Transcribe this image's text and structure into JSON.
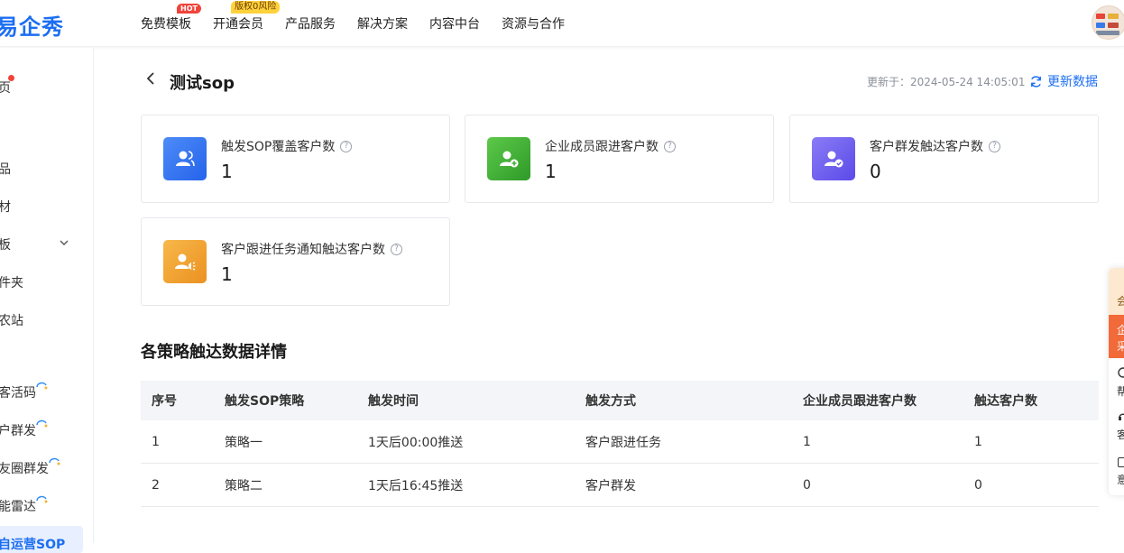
{
  "header": {
    "logo": "易企秀",
    "nav": [
      {
        "label": "免费模板",
        "badge": "HOT"
      },
      {
        "label": "开通会员",
        "badge": "版权0风险"
      },
      {
        "label": "产品服务"
      },
      {
        "label": "解决方案"
      },
      {
        "label": "内容中台"
      },
      {
        "label": "资源与合作"
      }
    ]
  },
  "sidebar": {
    "items": [
      {
        "label": "页"
      },
      {
        "label": "品"
      },
      {
        "label": "材"
      },
      {
        "label": "板"
      },
      {
        "label": "件夹"
      },
      {
        "label": "农站"
      },
      {
        "label": "客活码"
      },
      {
        "label": "户群发"
      },
      {
        "label": "友圈群发"
      },
      {
        "label": "能雷达"
      },
      {
        "label": "自运营SOP"
      }
    ]
  },
  "page": {
    "title": "测试sop",
    "updated_label": "更新于：2024-05-24 14:05:01",
    "refresh_label": "更新数据"
  },
  "stats": [
    {
      "label": "触发SOP覆盖客户数",
      "value": "1",
      "color": "#2f6df3"
    },
    {
      "label": "企业成员跟进客户数",
      "value": "1",
      "color": "#3fae32"
    },
    {
      "label": "客户群发触达客户数",
      "value": "0",
      "color": "#6a5cf0"
    },
    {
      "label": "客户跟进任务通知触达客户数",
      "value": "1",
      "color": "#f0a22c"
    }
  ],
  "detail": {
    "title": "各策略触达数据详情",
    "columns": [
      "序号",
      "触发SOP策略",
      "触发时间",
      "触发方式",
      "企业成员跟进客户数",
      "触达客户数"
    ],
    "rows": [
      [
        "1",
        "策略一",
        "1天后00:00推送",
        "客户跟进任务",
        "1",
        "1"
      ],
      [
        "2",
        "策略二",
        "1天后16:45推送",
        "客户群发",
        "0",
        "0"
      ]
    ]
  },
  "float_panel": {
    "items": [
      "会",
      "企",
      "采",
      "帮",
      "客",
      "意"
    ]
  },
  "icons": {
    "back": "chevron-left-icon",
    "refresh": "refresh-icon",
    "help": "question-circle-icon"
  }
}
